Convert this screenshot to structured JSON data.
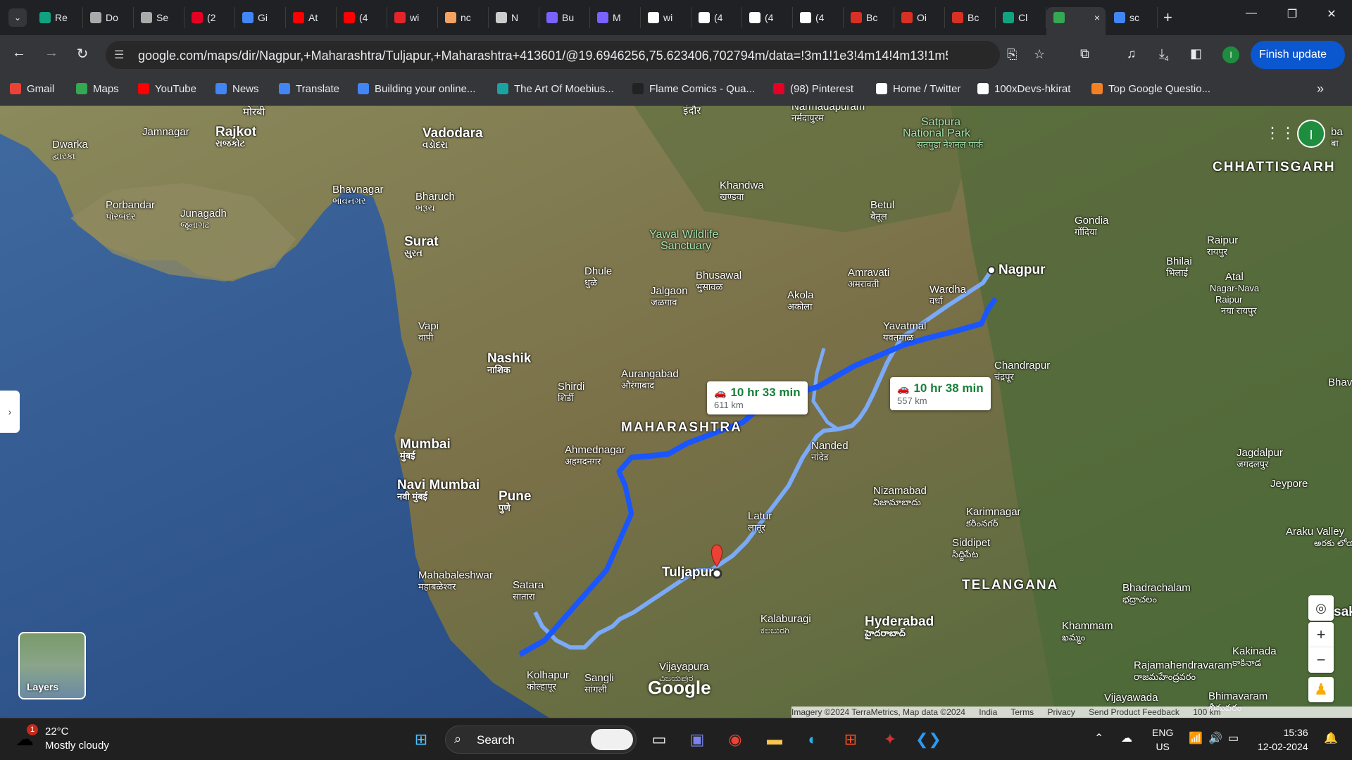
{
  "browser": {
    "tabs": [
      {
        "label": "Re",
        "icon": "chatgpt-icon",
        "color": "#10a37f"
      },
      {
        "label": "Do",
        "icon": "download-icon",
        "color": "#aaaaaa"
      },
      {
        "label": "Se",
        "icon": "gear-icon",
        "color": "#aaaaaa"
      },
      {
        "label": "(2",
        "icon": "pinterest-icon",
        "color": "#e60023"
      },
      {
        "label": "Gi",
        "icon": "gi-icon",
        "color": "#4285f4"
      },
      {
        "label": "At",
        "icon": "youtube-icon",
        "color": "#ff0000"
      },
      {
        "label": "(4",
        "icon": "youtube-icon",
        "color": "#ff0000"
      },
      {
        "label": "wi",
        "icon": "webtoon-icon",
        "color": "#e3242b"
      },
      {
        "label": "nc",
        "icon": "nc-icon",
        "color": "#f4a261"
      },
      {
        "label": "N",
        "icon": "chatgpt-icon",
        "color": "#cccccc"
      },
      {
        "label": "Bu",
        "icon": "bu-icon",
        "color": "#7b61ff"
      },
      {
        "label": "M",
        "icon": "bu-icon",
        "color": "#7b61ff"
      },
      {
        "label": "wi",
        "icon": "github-icon",
        "color": "#ffffff"
      },
      {
        "label": "(4",
        "icon": "x-icon",
        "color": "#ffffff"
      },
      {
        "label": "(4",
        "icon": "x-icon",
        "color": "#ffffff"
      },
      {
        "label": "(4",
        "icon": "x-icon",
        "color": "#ffffff"
      },
      {
        "label": "Bc",
        "icon": "bc-icon",
        "color": "#d93025"
      },
      {
        "label": "Oi",
        "icon": "bc-icon",
        "color": "#d93025"
      },
      {
        "label": "Bc",
        "icon": "bc-icon",
        "color": "#d93025"
      },
      {
        "label": "Cl",
        "icon": "chatgpt-icon",
        "color": "#10a37f"
      },
      {
        "label": "",
        "icon": "maps-icon",
        "color": "#34a853",
        "active": true
      },
      {
        "label": "sc",
        "icon": "google-icon",
        "color": "#4285f4"
      }
    ],
    "tab_close": "×",
    "new_tab": "+",
    "url": "google.com/maps/dir/Nagpur,+Maharashtra/Tuljapur,+Maharashtra+413601/@19.6946256,75.623406,702794m/data=!3m1!1e3!4m14!4m13!1m5!1m1!1s0x...",
    "finish_update": "Finish update",
    "profile_initial": "I",
    "download_count": "4",
    "bookmarks": [
      {
        "label": "Gmail",
        "icon": "gmail-icon",
        "color": "#ea4335"
      },
      {
        "label": "Maps",
        "icon": "maps-icon",
        "color": "#34a853"
      },
      {
        "label": "YouTube",
        "icon": "youtube-icon",
        "color": "#ff0000"
      },
      {
        "label": "News",
        "icon": "news-icon",
        "color": "#4285f4"
      },
      {
        "label": "Translate",
        "icon": "translate-icon",
        "color": "#4285f4"
      },
      {
        "label": "Building your online...",
        "icon": "google-icon",
        "color": "#4285f4"
      },
      {
        "label": "The Art Of Moebius...",
        "icon": "moebius-icon",
        "color": "#1aa3a3"
      },
      {
        "label": "Flame Comics - Qua...",
        "icon": "flame-icon",
        "color": "#222222"
      },
      {
        "label": "(98) Pinterest",
        "icon": "pinterest-icon",
        "color": "#e60023"
      },
      {
        "label": "Home / Twitter",
        "icon": "x-icon",
        "color": "#ffffff"
      },
      {
        "label": "100xDevs-hkirat",
        "icon": "github-icon",
        "color": "#ffffff"
      },
      {
        "label": "Top Google Questio...",
        "icon": "stackoverflow-icon",
        "color": "#f48024"
      }
    ]
  },
  "map": {
    "route_primary": {
      "time": "10 hr 33 min",
      "distance": "611 km"
    },
    "route_alt": {
      "time": "10 hr 38 min",
      "distance": "557 km"
    },
    "origin": "Nagpur",
    "destination": "Tuljapur",
    "labels": {
      "morbi": "मोरबी",
      "indore": "इंदौर",
      "narmadapuram": "Narmadapuram",
      "narmadapuram_sub": "नर्मदापुरम",
      "satpura": "Satpura",
      "satpura2": "National Park",
      "satpura_sub": "सतपुड़ा नेशनल पार्क",
      "dwarka": "Dwarka",
      "dwarka_sub": "દ્વારકા",
      "jamnagar": "Jamnagar",
      "rajkot": "Rajkot",
      "rajkot_sub": "રાજકોટ",
      "vadodara": "Vadodara",
      "vadodara_sub": "વડોદરા",
      "porbandar": "Porbandar",
      "porbandar_sub": "પોરબંદર",
      "junagadh": "Junagadh",
      "junagadh_sub": "જૂનાગઢ",
      "bhavnagar": "Bhavnagar",
      "bhavnagar_sub": "ભાવનગર",
      "bharuch": "Bharuch",
      "bharuch_sub": "ભરૂચ",
      "surat": "Surat",
      "surat_sub": "સુરત",
      "khandwa": "Khandwa",
      "khandwa_sub": "खण्डवा",
      "betul": "Betul",
      "betul_sub": "बैतूल",
      "yawal": "Yawal Wildlife",
      "yawal2": "Sanctuary",
      "dhule": "Dhule",
      "dhule_sub": "धुळे",
      "bhusawal": "Bhusawal",
      "bhusawal_sub": "भुसावळ",
      "jalgaon": "Jalgaon",
      "jalgaon_sub": "जळगाव",
      "akola": "Akola",
      "akola_sub": "अकोला",
      "amravati": "Amravati",
      "amravati_sub": "अमरावती",
      "wardha": "Wardha",
      "wardha_sub": "वर्धा",
      "yavatmal": "Yavatmal",
      "yavatmal_sub": "यवतमाळ",
      "gondia": "Gondia",
      "gondia_sub": "गोंदिया",
      "chhattisgarh": "CHHATTISGARH",
      "raipur": "Raipur",
      "raipur_sub": "रायपुर",
      "bhilai": "Bhilai",
      "bhilai_sub": "भिलाई",
      "atal": "Atal",
      "atal2": "Nagar-Nava",
      "atal3": "Raipur",
      "atal_sub": "नया रायपुर",
      "vapi": "Vapi",
      "vapi_sub": "वापी",
      "nashik": "Nashik",
      "nashik_sub": "नाशिक",
      "shirdi": "Shirdi",
      "shirdi_sub": "शिर्डी",
      "aurangabad": "Aurangabad",
      "aurangabad_sub": "औरंगाबाद",
      "maharashtra": "MAHARASHTRA",
      "chandrapur": "Chandrapur",
      "chandrapur_sub": "चंद्रपूर",
      "mumbai": "Mumbai",
      "mumbai_sub": "मुंबई",
      "navimumbai": "Navi Mumbai",
      "navimumbai_sub": "नवी मुंबई",
      "ahmednagar": "Ahmednagar",
      "ahmednagar_sub": "अहमदनगर",
      "nanded": "Nanded",
      "nanded_sub": "नांदेड",
      "nizamabad": "Nizamabad",
      "nizamabad_sub": "నిజామాబాదు",
      "karimnagar": "Karimnagar",
      "karimnagar_sub": "కరీంనగర్",
      "siddipet": "Siddipet",
      "siddipet_sub": "సిద్దిపేట",
      "jagdalpur": "Jagdalpur",
      "jagdalpur_sub": "जगदलपुर",
      "jeypore": "Jeypore",
      "pune": "Pune",
      "pune_sub": "पुणे",
      "latur": "Latur",
      "latur_sub": "लातूर",
      "mahabaleshwar": "Mahabaleshwar",
      "mahabaleshwar_sub": "महाबळेश्वर",
      "satara": "Satara",
      "satara_sub": "सातारा",
      "telangana": "TELANGANA",
      "bhadrachalam": "Bhadrachalam",
      "bhadrachalam_sub": "భద్రాచలం",
      "arakuvalley": "Araku Valley",
      "arakuvalley_sub": "అరకు లోయ",
      "kalaburagi": "Kalaburagi",
      "kalaburagi_sub": "ಕಲಬುರಗಿ",
      "hyderabad": "Hyderabad",
      "hyderabad_sub": "హైదరాబాద్",
      "khammam": "Khammam",
      "khammam_sub": "ఖమ్మం",
      "kakinada": "Kakinada",
      "kakinada_sub": "కాకినాడ",
      "rajahmundry": "Rajamahendravaram",
      "rajahmundry_sub": "రాజమహేంద్రవరం",
      "kolhapur": "Kolhapur",
      "kolhapur_sub": "कोल्हापूर",
      "sangli": "Sangli",
      "sangli_sub": "सांगली",
      "vijayapura": "Vijayapura",
      "vijayapura_sub": "ವಿಜಯಪುರ",
      "vijayawada": "Vijayawada",
      "bhimavaram": "Bhimavaram",
      "bhimavaram_sub": "భీమవరం",
      "bhav": "Bhav",
      "ba": "ba",
      "ba_sub": "बा",
      "sak": "sak"
    },
    "layers": "Layers",
    "google_logo": "Google",
    "attribution": [
      "Imagery ©2024 TerraMetrics, Map data ©2024",
      "India",
      "Terms",
      "Privacy",
      "Send Product Feedback",
      "100 km"
    ],
    "zoom_in": "+",
    "zoom_out": "−"
  },
  "taskbar": {
    "weather_temp": "22°C",
    "weather_desc": "Mostly cloudy",
    "weather_badge": "1",
    "search": "Search",
    "lang1": "ENG",
    "lang2": "US",
    "time": "15:36",
    "date": "12-02-2024"
  }
}
